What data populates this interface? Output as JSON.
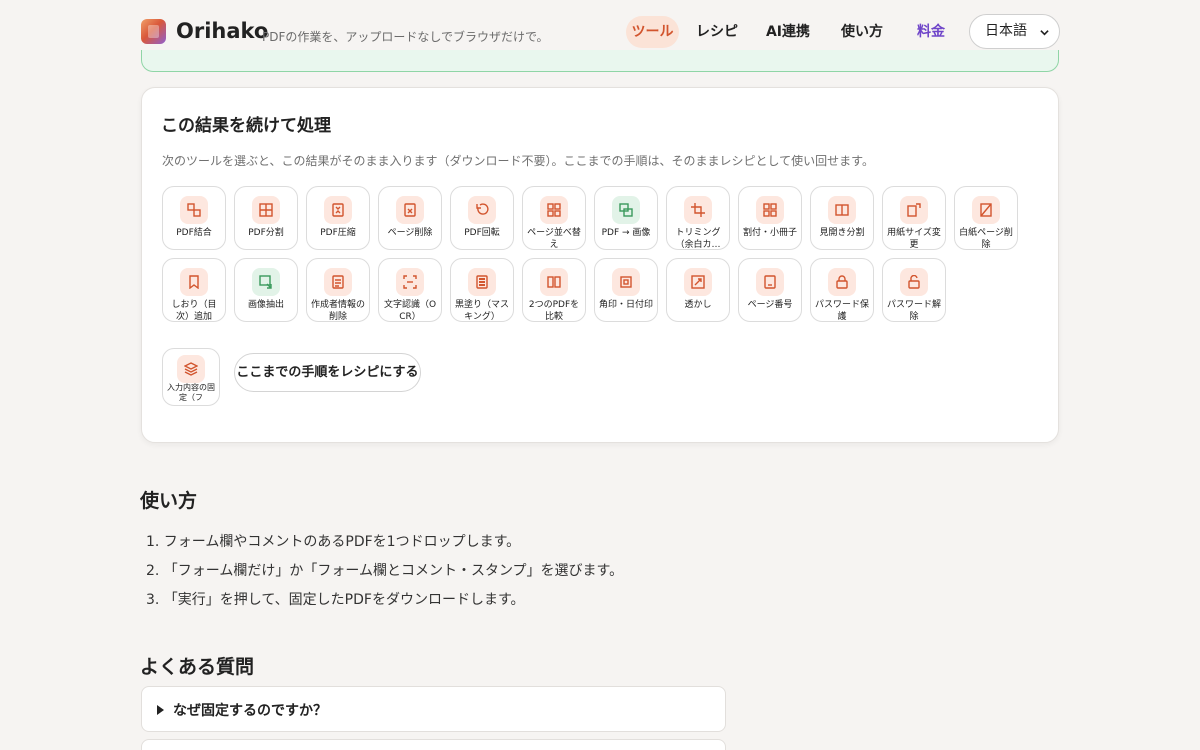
{
  "header": {
    "brand": "Orihako",
    "tagline": "PDFの作業を、アップロードなしでブラウザだけで。",
    "nav": [
      "ツール",
      "レシピ",
      "AI連携",
      "使い方",
      "料金"
    ],
    "language": "日本語"
  },
  "card": {
    "title": "この結果を続けて処理",
    "description": "次のツールを選ぶと、この結果がそのまま入ります（ダウンロード不要）。ここまでの手順は、そのままレシピとして使い回せます。",
    "tools": [
      {
        "label": "PDF結合",
        "icon": "merge-icon"
      },
      {
        "label": "PDF分割",
        "icon": "split-icon"
      },
      {
        "label": "PDF圧縮",
        "icon": "compress-icon"
      },
      {
        "label": "ページ削除",
        "icon": "delete-page-icon"
      },
      {
        "label": "PDF回転",
        "icon": "rotate-icon"
      },
      {
        "label": "ページ並べ替え",
        "icon": "grid-icon"
      },
      {
        "label": "PDF → 画像",
        "icon": "image-convert-icon"
      },
      {
        "label": "トリミング（余白カ…",
        "icon": "crop-icon"
      },
      {
        "label": "割付・小冊子",
        "icon": "booklet-icon"
      },
      {
        "label": "見開き分割",
        "icon": "spread-split-icon"
      },
      {
        "label": "用紙サイズ変更",
        "icon": "resize-icon"
      },
      {
        "label": "白紙ページ削除",
        "icon": "blank-page-icon"
      },
      {
        "label": "しおり（目次）追加",
        "icon": "bookmark-icon"
      },
      {
        "label": "画像抽出",
        "icon": "image-extract-icon"
      },
      {
        "label": "作成者情報の削除",
        "icon": "document-icon"
      },
      {
        "label": "文字認識（OCR）",
        "icon": "ocr-icon"
      },
      {
        "label": "黒塗り（マスキング）",
        "icon": "redact-icon"
      },
      {
        "label": "2つのPDFを比較",
        "icon": "compare-icon"
      },
      {
        "label": "角印・日付印",
        "icon": "stamp-icon"
      },
      {
        "label": "透かし",
        "icon": "watermark-icon"
      },
      {
        "label": "ページ番号",
        "icon": "page-number-icon"
      },
      {
        "label": "パスワード保護",
        "icon": "lock-icon"
      },
      {
        "label": "パスワード解除",
        "icon": "unlock-icon"
      },
      {
        "label": "入力内容の固定（フ",
        "icon": "layers-icon"
      }
    ],
    "recipe_button": "ここまでの手順をレシピにする"
  },
  "usage": {
    "title": "使い方",
    "steps": [
      "1. フォーム欄やコメントのあるPDFを1つドロップします。",
      "2. 「フォーム欄だけ」か「フォーム欄とコメント・スタンプ」を選びます。",
      "3. 「実行」を押して、固定したPDFをダウンロードします。"
    ]
  },
  "faq": {
    "title": "よくある質問",
    "items": [
      "なぜ固定するのですか？"
    ]
  },
  "colors": {
    "accent": "#d2552e",
    "accent_bg": "#fde7df",
    "pricing": "#6f45c9",
    "success": "#8fd5a6"
  }
}
